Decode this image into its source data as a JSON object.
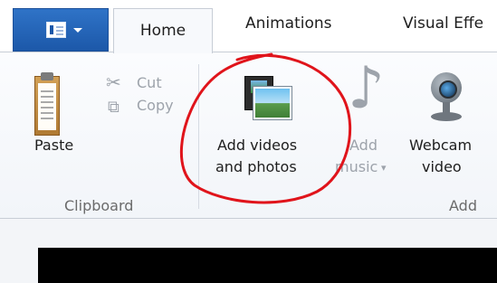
{
  "tabs": [
    {
      "label": "Home",
      "active": true
    },
    {
      "label": "Animations"
    },
    {
      "label": "Visual Effe"
    }
  ],
  "clipboard": {
    "paste_label": "Paste",
    "cut_label": "Cut",
    "copy_label": "Copy",
    "group_label": "Clipboard"
  },
  "add": {
    "add_videos_line1": "Add videos",
    "add_videos_line2": "and photos",
    "add_music_line1": "Add",
    "add_music_line2": "music",
    "webcam_line1": "Webcam",
    "webcam_line2": "video",
    "group_label": "Add"
  },
  "icons": {
    "app_menu": "document-menu-icon",
    "paste": "clipboard-icon",
    "cut": "scissors-icon",
    "copy": "copy-icon",
    "add_videos": "film-photo-icon",
    "add_music": "music-note-icon",
    "webcam": "webcam-icon",
    "dropdown": "chevron-down-icon"
  },
  "annotation": {
    "color": "#e0141b"
  }
}
